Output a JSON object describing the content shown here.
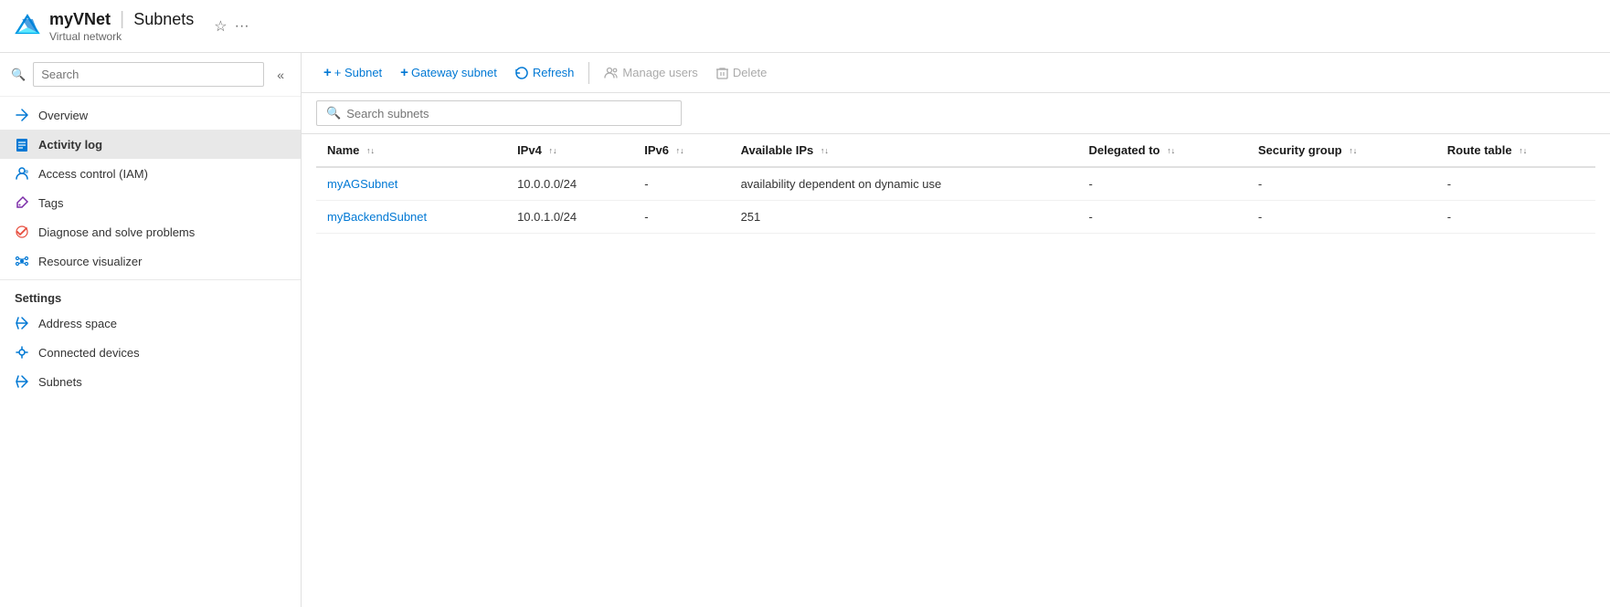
{
  "header": {
    "resource_name": "myVNet",
    "separator": "|",
    "section": "Subnets",
    "subtitle": "Virtual network",
    "star_icon": "☆",
    "more_icon": "···"
  },
  "sidebar": {
    "search_placeholder": "Search",
    "collapse_icon": "«",
    "nav_items": [
      {
        "id": "overview",
        "label": "Overview",
        "icon": "arrows",
        "active": false
      },
      {
        "id": "activity-log",
        "label": "Activity log",
        "icon": "doc",
        "active": true
      },
      {
        "id": "access-control",
        "label": "Access control (IAM)",
        "icon": "people",
        "active": false
      },
      {
        "id": "tags",
        "label": "Tags",
        "icon": "tag",
        "active": false
      },
      {
        "id": "diagnose",
        "label": "Diagnose and solve problems",
        "icon": "wrench",
        "active": false
      },
      {
        "id": "resource-visualizer",
        "label": "Resource visualizer",
        "icon": "graph",
        "active": false
      }
    ],
    "settings_label": "Settings",
    "settings_items": [
      {
        "id": "address-space",
        "label": "Address space",
        "icon": "arrows",
        "active": false
      },
      {
        "id": "connected-devices",
        "label": "Connected devices",
        "icon": "plug",
        "active": false
      },
      {
        "id": "subnets",
        "label": "Subnets",
        "icon": "arrows",
        "active": false
      }
    ]
  },
  "toolbar": {
    "add_subnet_label": "+ Subnet",
    "add_gateway_label": "+ Gateway subnet",
    "refresh_label": "Refresh",
    "manage_users_label": "Manage users",
    "delete_label": "Delete"
  },
  "search_subnets": {
    "placeholder": "Search subnets"
  },
  "table": {
    "columns": [
      {
        "id": "name",
        "label": "Name"
      },
      {
        "id": "ipv4",
        "label": "IPv4"
      },
      {
        "id": "ipv6",
        "label": "IPv6"
      },
      {
        "id": "available_ips",
        "label": "Available IPs"
      },
      {
        "id": "delegated_to",
        "label": "Delegated to"
      },
      {
        "id": "security_group",
        "label": "Security group"
      },
      {
        "id": "route_table",
        "label": "Route table"
      }
    ],
    "rows": [
      {
        "name": "myAGSubnet",
        "ipv4": "10.0.0.0/24",
        "ipv6": "-",
        "available_ips": "availability dependent on dynamic use",
        "delegated_to": "-",
        "security_group": "-",
        "route_table": "-"
      },
      {
        "name": "myBackendSubnet",
        "ipv4": "10.0.1.0/24",
        "ipv6": "-",
        "available_ips": "251",
        "delegated_to": "-",
        "security_group": "-",
        "route_table": "-"
      }
    ]
  },
  "colors": {
    "azure_blue": "#0078d4",
    "active_bg": "#e8e8e8",
    "border": "#e0e0e0"
  }
}
